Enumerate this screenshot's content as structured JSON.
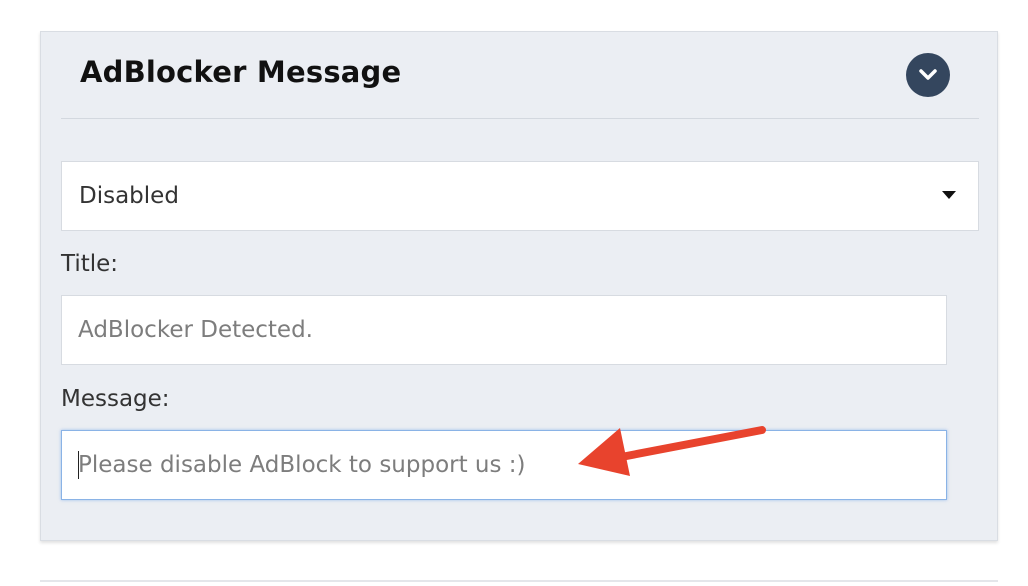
{
  "panel": {
    "title": "AdBlocker Message",
    "toggle_icon": "chevron-down-icon"
  },
  "status_select": {
    "selected": "Disabled"
  },
  "title_field": {
    "label": "Title:",
    "placeholder": "AdBlocker Detected."
  },
  "message_field": {
    "label": "Message:",
    "placeholder": "Please disable AdBlock to support us :)"
  },
  "colors": {
    "panel_bg": "#ebeef3",
    "toggle_bg": "#34465e",
    "annotation_arrow": "#e8432d",
    "focus_border": "#8ab3e6"
  }
}
